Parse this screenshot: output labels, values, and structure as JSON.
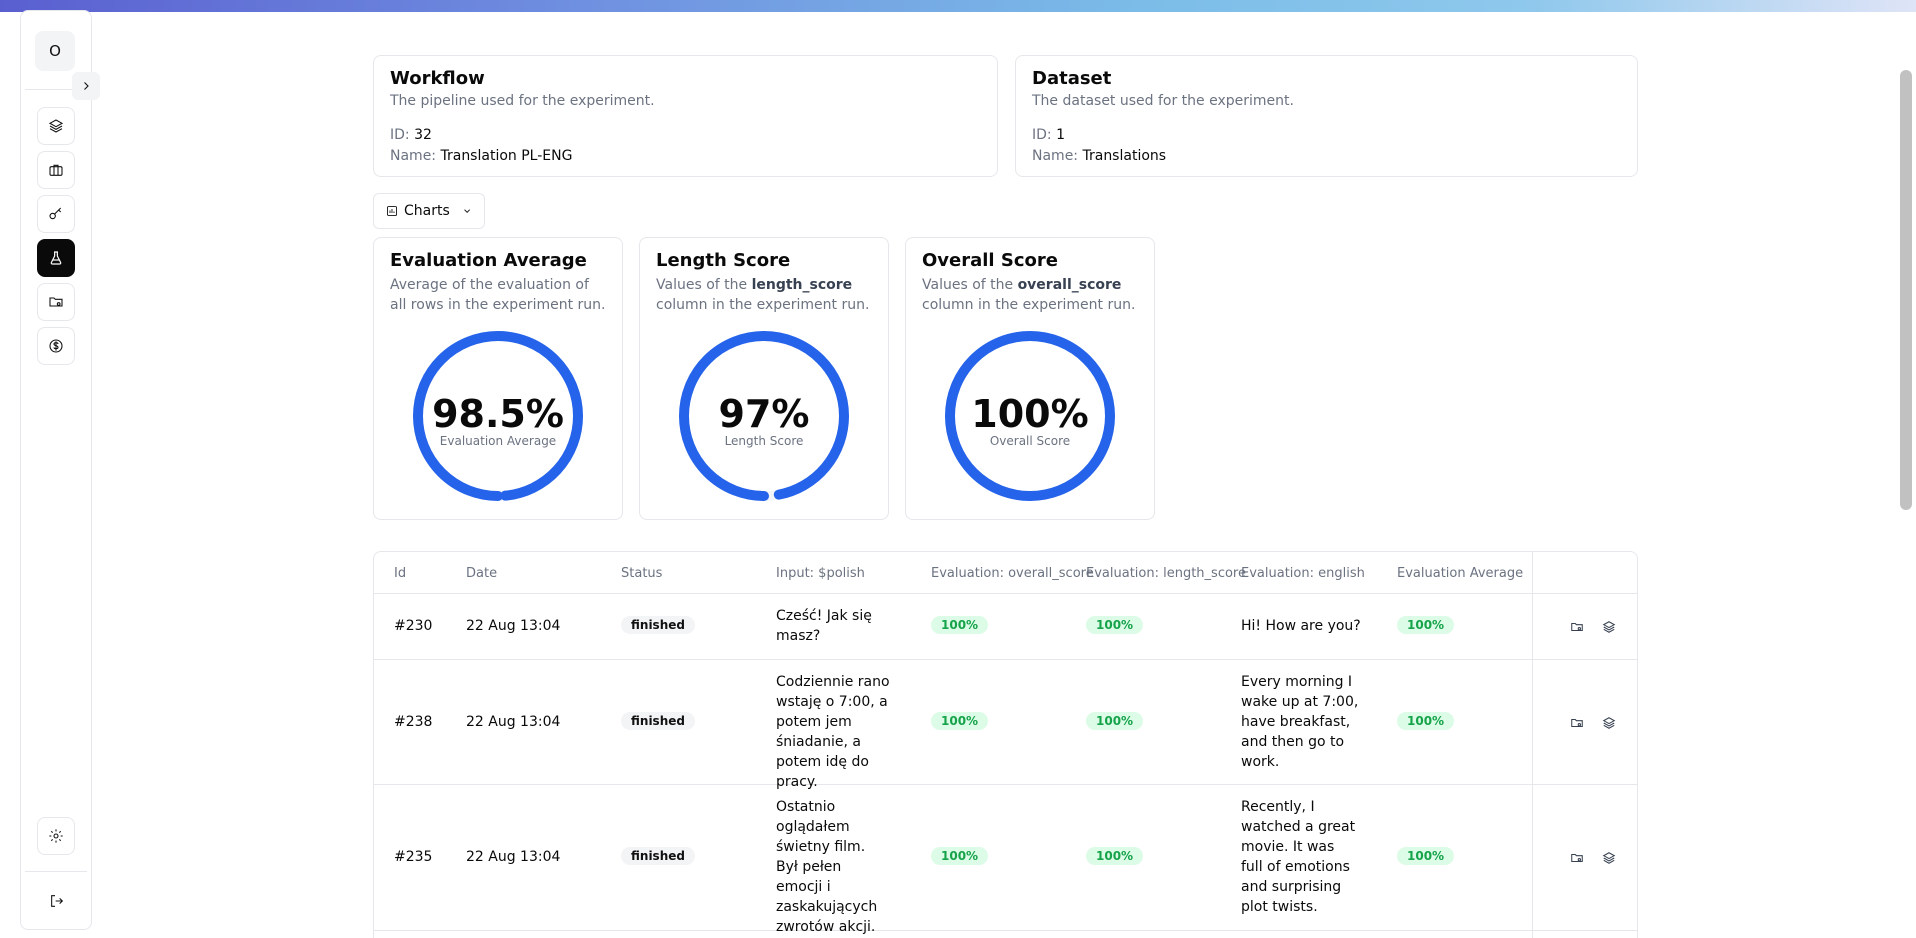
{
  "sidebar": {
    "avatar_letter": "O",
    "items": [
      {
        "icon": "layers-icon"
      },
      {
        "icon": "briefcase-icon"
      },
      {
        "icon": "key-icon"
      },
      {
        "icon": "flask-icon",
        "active": true
      },
      {
        "icon": "folder-settings-icon"
      },
      {
        "icon": "dollar-icon"
      }
    ],
    "settings_icon": "gear-icon",
    "logout_icon": "logout-icon"
  },
  "workflow": {
    "title": "Workflow",
    "description": "The pipeline used for the experiment.",
    "id_label": "ID:",
    "id_value": "32",
    "name_label": "Name:",
    "name_value": "Translation PL-ENG"
  },
  "dataset": {
    "title": "Dataset",
    "description": "The dataset used for the experiment.",
    "id_label": "ID:",
    "id_value": "1",
    "name_label": "Name:",
    "name_value": "Translations"
  },
  "charts_button": {
    "label": "Charts"
  },
  "charts": [
    {
      "title": "Evaluation Average",
      "desc_pre": "Average of the evaluation of all rows in the experiment run.",
      "desc_bold": "",
      "desc_post": "",
      "value_text": "98.5%",
      "value_fraction": 0.985,
      "label": "Evaluation Average"
    },
    {
      "title": "Length Score",
      "desc_pre": "Values of the ",
      "desc_bold": "length_score",
      "desc_post": " column in the experiment run.",
      "value_text": "97%",
      "value_fraction": 0.97,
      "label": "Length Score"
    },
    {
      "title": "Overall Score",
      "desc_pre": "Values of the ",
      "desc_bold": "overall_score",
      "desc_post": " column in the experiment run.",
      "value_text": "100%",
      "value_fraction": 1.0,
      "label": "Overall Score"
    }
  ],
  "table": {
    "headers": [
      "Id",
      "Date",
      "Status",
      "Input: $polish",
      "Evaluation: overall_score",
      "Evaluation: length_score",
      "Evaluation: english",
      "Evaluation Average"
    ],
    "rows": [
      {
        "id": "#230",
        "date": "22 Aug 13:04",
        "status": "finished",
        "input": "Cześć! Jak się masz?",
        "overall": "100%",
        "length": "100%",
        "english": "Hi! How are you?",
        "average": "100%"
      },
      {
        "id": "#238",
        "date": "22 Aug 13:04",
        "status": "finished",
        "input": "Codziennie rano wstaję o 7:00, a potem jem śniadanie, a potem idę do pracy.",
        "overall": "100%",
        "length": "100%",
        "english": "Every morning I wake up at 7:00, have breakfast, and then go to work.",
        "average": "100%"
      },
      {
        "id": "#235",
        "date": "22 Aug 13:04",
        "status": "finished",
        "input": "Ostatnio oglądałem świetny film. Był pełen emocji i zaskakujących zwrotów akcji.",
        "overall": "100%",
        "length": "100%",
        "english": "Recently, I watched a great movie. It was full of emotions and surprising plot twists.",
        "average": "100%"
      }
    ]
  }
}
